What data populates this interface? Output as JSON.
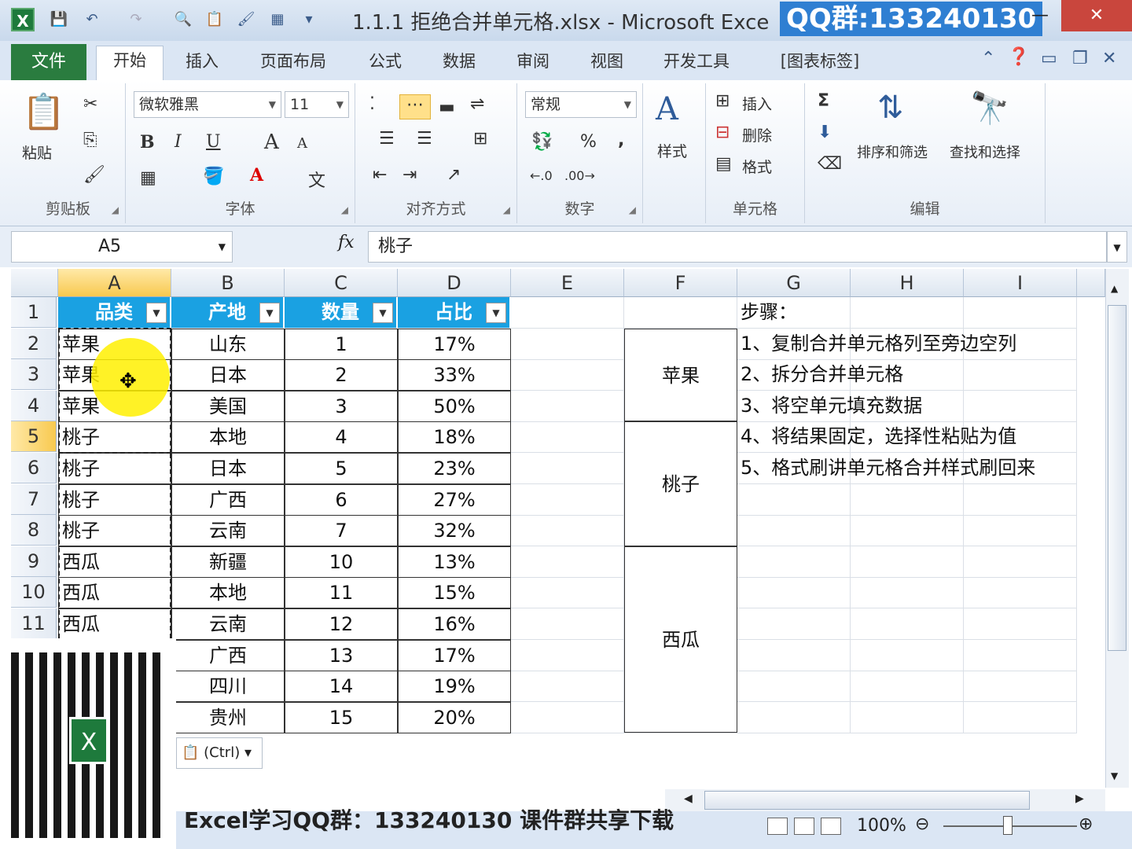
{
  "window": {
    "title": "1.1.1 拒绝合并单元格.xlsx - Microsoft Exce",
    "qq_banner": "QQ群:133240130",
    "app_icon": "X",
    "minimize": "—",
    "close": "✕"
  },
  "ribbon_tabs": [
    "文件",
    "开始",
    "插入",
    "页面布局",
    "公式",
    "数据",
    "审阅",
    "视图",
    "开发工具",
    "[图表标签]"
  ],
  "ribbon": {
    "clipboard": {
      "paste_label": "粘贴",
      "group_label": "剪贴板"
    },
    "font": {
      "font_name": "微软雅黑",
      "font_size": "11",
      "bold": "B",
      "italic": "I",
      "underline": "U",
      "grow": "A",
      "shrink": "A",
      "group_label": "字体"
    },
    "alignment": {
      "group_label": "对齐方式"
    },
    "number": {
      "format": "常规",
      "percent": "%",
      "comma": ",",
      "group_label": "数字"
    },
    "styles": {
      "label": "样式"
    },
    "cells": {
      "insert": "插入",
      "delete": "删除",
      "format": "格式",
      "group_label": "单元格"
    },
    "editing": {
      "sort_filter": "排序和筛选",
      "find_select": "查找和选择",
      "sum": "Σ",
      "group_label": "编辑"
    }
  },
  "formula_bar": {
    "name_box": "A5",
    "fx": "fx",
    "content": "桃子"
  },
  "columns": [
    "A",
    "B",
    "C",
    "D",
    "E",
    "F",
    "G",
    "H",
    "I"
  ],
  "rows": [
    "1",
    "2",
    "3",
    "4",
    "5",
    "6",
    "7",
    "8",
    "9",
    "10",
    "11"
  ],
  "table": {
    "headers": [
      "品类",
      "产地",
      "数量",
      "占比"
    ],
    "data": [
      [
        "苹果",
        "山东",
        "1",
        "17%"
      ],
      [
        "苹果",
        "日本",
        "2",
        "33%"
      ],
      [
        "苹果",
        "美国",
        "3",
        "50%"
      ],
      [
        "桃子",
        "本地",
        "4",
        "18%"
      ],
      [
        "桃子",
        "日本",
        "5",
        "23%"
      ],
      [
        "桃子",
        "广西",
        "6",
        "27%"
      ],
      [
        "桃子",
        "云南",
        "7",
        "32%"
      ],
      [
        "西瓜",
        "新疆",
        "10",
        "13%"
      ],
      [
        "西瓜",
        "本地",
        "11",
        "15%"
      ],
      [
        "西瓜",
        "云南",
        "12",
        "16%"
      ],
      [
        "",
        "广西",
        "13",
        "17%"
      ],
      [
        "",
        "四川",
        "14",
        "19%"
      ],
      [
        "",
        "贵州",
        "15",
        "20%"
      ]
    ]
  },
  "merged_f": [
    "苹果",
    "桃子",
    "西瓜"
  ],
  "steps": {
    "title": "步骤：",
    "items": [
      "1、复制合并单元格列至旁边空列",
      "2、拆分合并单元格",
      "3、将空单元填充数据",
      "4、将结果固定，选择性粘贴为值",
      "5、格式刷讲单元格合并样式刷回来"
    ]
  },
  "paste_options": "(Ctrl)",
  "bottom_caption": "Excel学习QQ群：133240130 课件群共享下载",
  "status": {
    "zoom": "100%"
  }
}
